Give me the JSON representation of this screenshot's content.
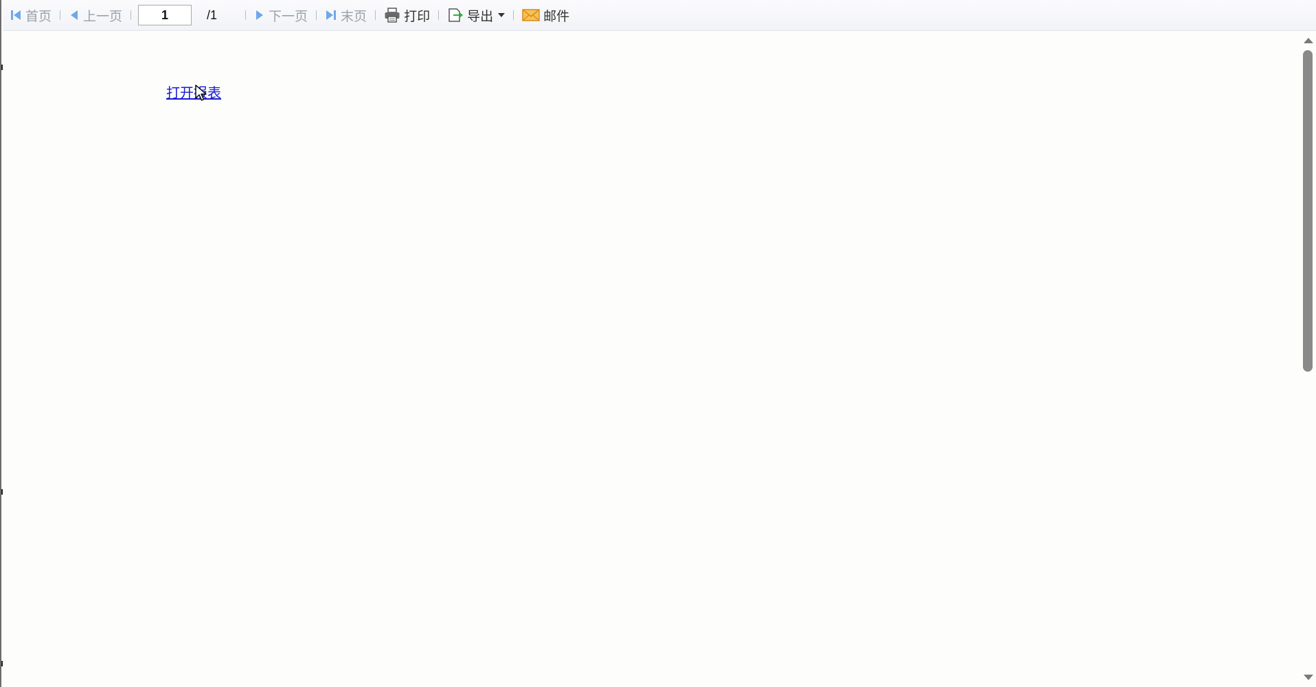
{
  "toolbar": {
    "first_label": "首页",
    "prev_label": "上一页",
    "page_value": "1",
    "total_pages": "/1",
    "next_label": "下一页",
    "last_label": "末页",
    "print_label": "打印",
    "export_label": "导出",
    "mail_label": "邮件"
  },
  "icons": {
    "first": "first-page-icon",
    "prev": "prev-page-icon",
    "next": "next-page-icon",
    "last": "last-page-icon",
    "print": "printer-icon",
    "export": "export-icon",
    "mail": "mail-icon"
  },
  "main": {
    "link_label": "打开报表"
  },
  "colors": {
    "nav_disabled": "#9aa0aa",
    "nav_icon": "#6fa8e8",
    "link": "#1a1ad8",
    "export_arrow": "#2fae44",
    "mail": "#f0a020"
  }
}
